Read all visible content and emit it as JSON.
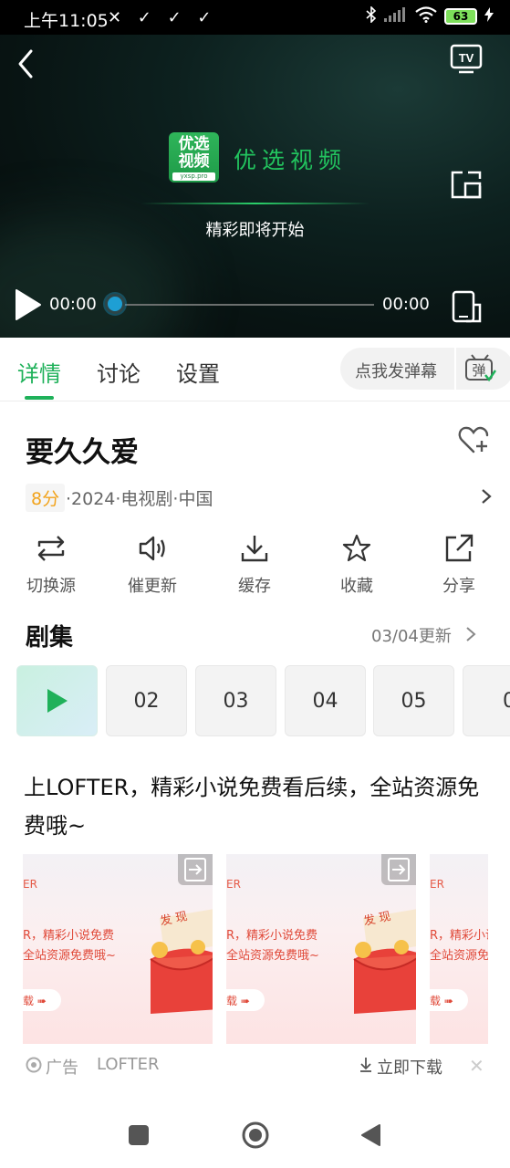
{
  "status_bar": {
    "time": "上午11:05",
    "notif_icons": "✕ ✓ ✓ ✓",
    "battery": "63"
  },
  "player": {
    "brand_logo_line1": "优选",
    "brand_logo_line2": "视频",
    "brand_logo_url": "yxsp.pro",
    "brand_name": "优选视频",
    "loading_text": "精彩即将开始",
    "current_time": "00:00",
    "total_time": "00:00",
    "progress": 0
  },
  "tabs": [
    {
      "label": "详情",
      "active": true
    },
    {
      "label": "讨论",
      "active": false
    },
    {
      "label": "设置",
      "active": false
    }
  ],
  "danmu": {
    "placeholder": "点我发弹幕",
    "icon_char": "弹"
  },
  "show": {
    "title": "要久久爱",
    "score": "8分",
    "meta": "·2024·电视剧·中国"
  },
  "actions": [
    {
      "label": "切换源",
      "icon": "switch-source-icon"
    },
    {
      "label": "催更新",
      "icon": "speaker-icon"
    },
    {
      "label": "缓存",
      "icon": "download-icon"
    },
    {
      "label": "收藏",
      "icon": "star-icon"
    },
    {
      "label": "分享",
      "icon": "share-icon"
    }
  ],
  "episodes": {
    "title": "剧集",
    "update_text": "03/04更新",
    "items": [
      "",
      "02",
      "03",
      "04",
      "05",
      "0"
    ]
  },
  "ad": {
    "title": "上LOFTER，精彩小说免费看后续，全站资源免费哦~",
    "card_ter": "ER",
    "card_line1": "R，精彩小说免费",
    "card_line2": "全站资源免费哦~",
    "card_dl": "载 ➠",
    "card_fx": "发 现",
    "tag": "广告",
    "source": "LOFTER",
    "download": "立即下载",
    "close": "✕"
  }
}
